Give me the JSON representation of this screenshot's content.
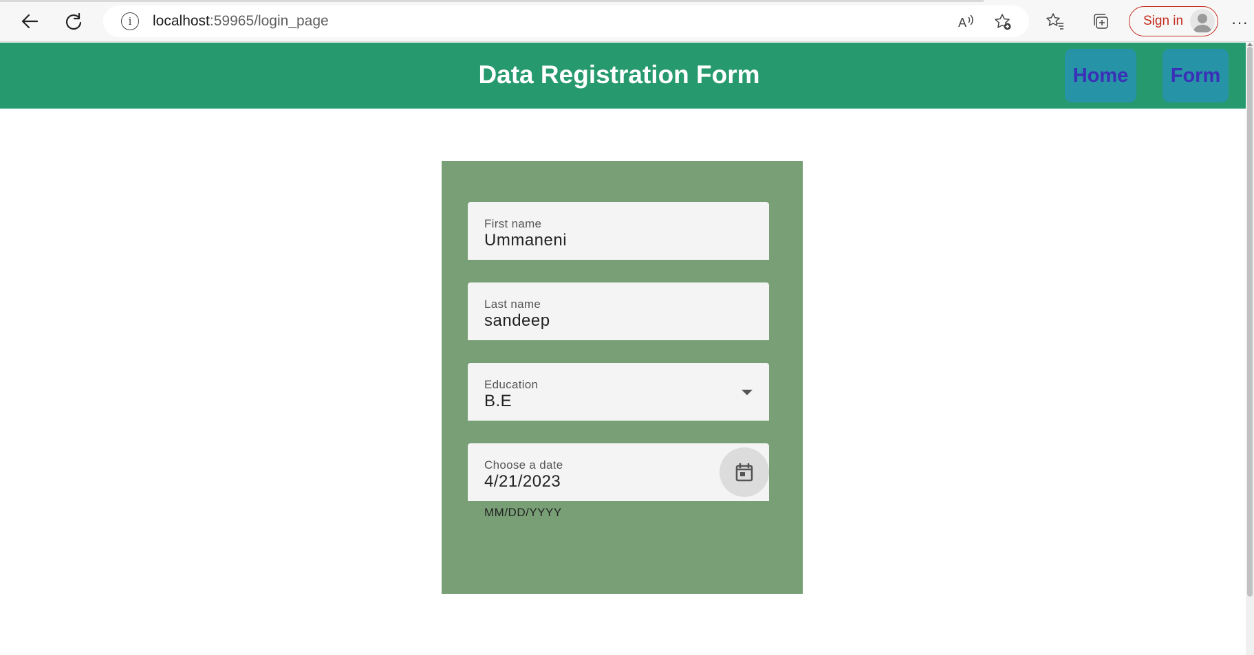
{
  "browser": {
    "url_host": "localhost",
    "url_path": ":59965/login_page",
    "signin_label": "Sign in",
    "more_label": "···"
  },
  "header": {
    "title": "Data Registration Form",
    "nav": [
      {
        "label": "Home"
      },
      {
        "label": "Form"
      }
    ]
  },
  "form": {
    "first_name": {
      "label": "First name",
      "value": "Ummaneni"
    },
    "last_name": {
      "label": "Last name",
      "value": "sandeep"
    },
    "education": {
      "label": "Education",
      "value": "B.E"
    },
    "date": {
      "label": "Choose a date",
      "value": "4/21/2023",
      "hint": "MM/DD/YYYY"
    }
  },
  "colors": {
    "header_bg": "#269a6e",
    "nav_button_bg": "#2693a6",
    "nav_text": "#3b2fb8",
    "card_bg": "#789f76",
    "signin_accent": "#c42b1c"
  },
  "icons": [
    "back-arrow-icon",
    "refresh-icon",
    "info-icon",
    "read-aloud-icon",
    "add-favorite-icon",
    "favorites-icon",
    "collections-icon",
    "profile-icon",
    "dropdown-arrow-icon",
    "calendar-icon"
  ]
}
